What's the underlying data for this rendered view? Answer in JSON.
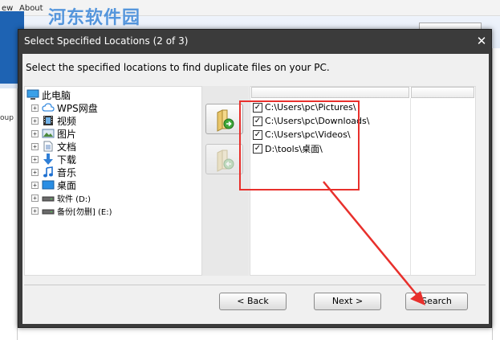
{
  "background": {
    "menu": [
      "ew",
      "About"
    ],
    "watermark": "河东软件园",
    "left_fragment": "oup"
  },
  "dialog": {
    "title": "Select Specified Locations (2 of 3)",
    "close": "✕",
    "instruction": "Select the specified locations to find duplicate files on your PC."
  },
  "tree": {
    "root_label": "此电脑",
    "items": [
      {
        "label": "WPS网盘",
        "icon": "cloud-icon"
      },
      {
        "label": "视频",
        "icon": "video-icon"
      },
      {
        "label": "图片",
        "icon": "pictures-icon"
      },
      {
        "label": "文档",
        "icon": "documents-icon"
      },
      {
        "label": "下载",
        "icon": "download-icon"
      },
      {
        "label": "音乐",
        "icon": "music-icon"
      },
      {
        "label": "桌面",
        "icon": "desktop-icon"
      },
      {
        "label": "软件 (D:)",
        "icon": "drive-icon"
      },
      {
        "label": "备份[勿删] (E:)",
        "icon": "drive-icon"
      }
    ]
  },
  "selected_locations": {
    "checked_mark": "✓",
    "items": [
      {
        "path": "C:\\Users\\pc\\Pictures\\",
        "checked": true
      },
      {
        "path": "C:\\Users\\pc\\Downloads\\",
        "checked": true
      },
      {
        "path": "C:\\Users\\pc\\Videos\\",
        "checked": true
      },
      {
        "path": "D:\\tools\\桌面\\",
        "checked": true
      }
    ]
  },
  "buttons": {
    "back": "< Back",
    "next": "Next >",
    "search": "Search"
  },
  "colors": {
    "annotation": "#e8302c",
    "dialog_frame": "#3b3b3b"
  }
}
